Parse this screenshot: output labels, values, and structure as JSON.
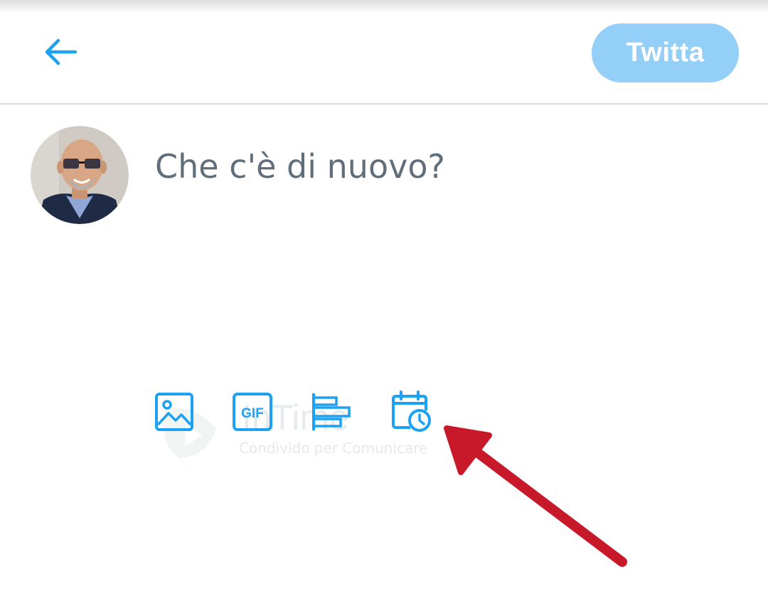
{
  "header": {
    "back_icon": "arrow-left-icon",
    "tweet_button_label": "Twitta"
  },
  "compose": {
    "placeholder": "Che c'è di nuovo?",
    "value": ""
  },
  "toolbar": {
    "items": [
      {
        "icon": "image-icon"
      },
      {
        "icon": "gif-icon",
        "label": "GIF"
      },
      {
        "icon": "poll-icon"
      },
      {
        "icon": "schedule-icon"
      }
    ]
  },
  "watermark": {
    "name": "InTime",
    "tagline": "Condivido per Comunicare"
  },
  "colors": {
    "accent": "#1da1f2",
    "button_disabled": "#93cff7",
    "placeholder": "#5f6e7a",
    "annotation_arrow": "#c8192a"
  }
}
